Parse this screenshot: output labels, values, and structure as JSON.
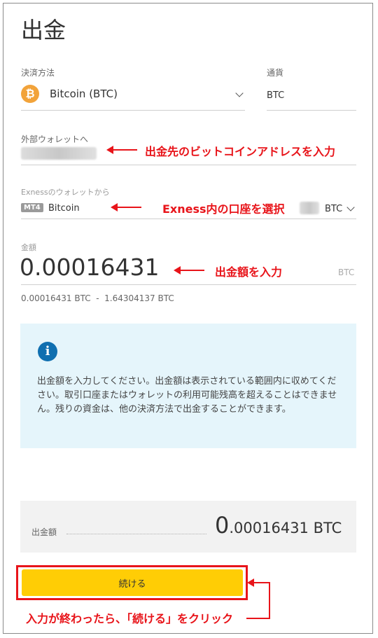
{
  "page": {
    "title": "出金"
  },
  "method": {
    "label": "決済方法",
    "value": "Bitcoin (BTC)",
    "icon": "bitcoin-icon"
  },
  "currency": {
    "label": "通貨",
    "value": "BTC"
  },
  "external_wallet": {
    "label": "外部ウォレットへ"
  },
  "exness_wallet": {
    "label": "Exnessのウォレットから",
    "badge": "MT4",
    "name": "Bitcoin",
    "currency": "BTC"
  },
  "amount": {
    "label": "金額",
    "value": "0.00016431",
    "unit": "BTC",
    "range": "0.00016431 BTC  -  1.64304137 BTC"
  },
  "info": {
    "icon": "info-icon",
    "text": "出金額を入力してください。出金額は表示されている範囲内に収めてください。取引口座またはウォレットの利用可能残高を超えることはできません。残りの資金は、他の決済方法で出金することができます。"
  },
  "summary": {
    "label": "出金額",
    "value_int": "0",
    "value_frac": ".00016431",
    "unit": "BTC"
  },
  "continue_button": {
    "label": "続ける"
  },
  "annotations": {
    "address": "出金先のビットコインアドレスを入力",
    "account": "Exness内の口座を選択",
    "amount": "出金額を入力",
    "click": "入力が終わったら、「続ける」をクリック"
  },
  "colors": {
    "accent": "#ffcd05",
    "annotation": "#e8141a",
    "info_bg": "#e5f5fb",
    "bitcoin": "#f2a33a"
  }
}
